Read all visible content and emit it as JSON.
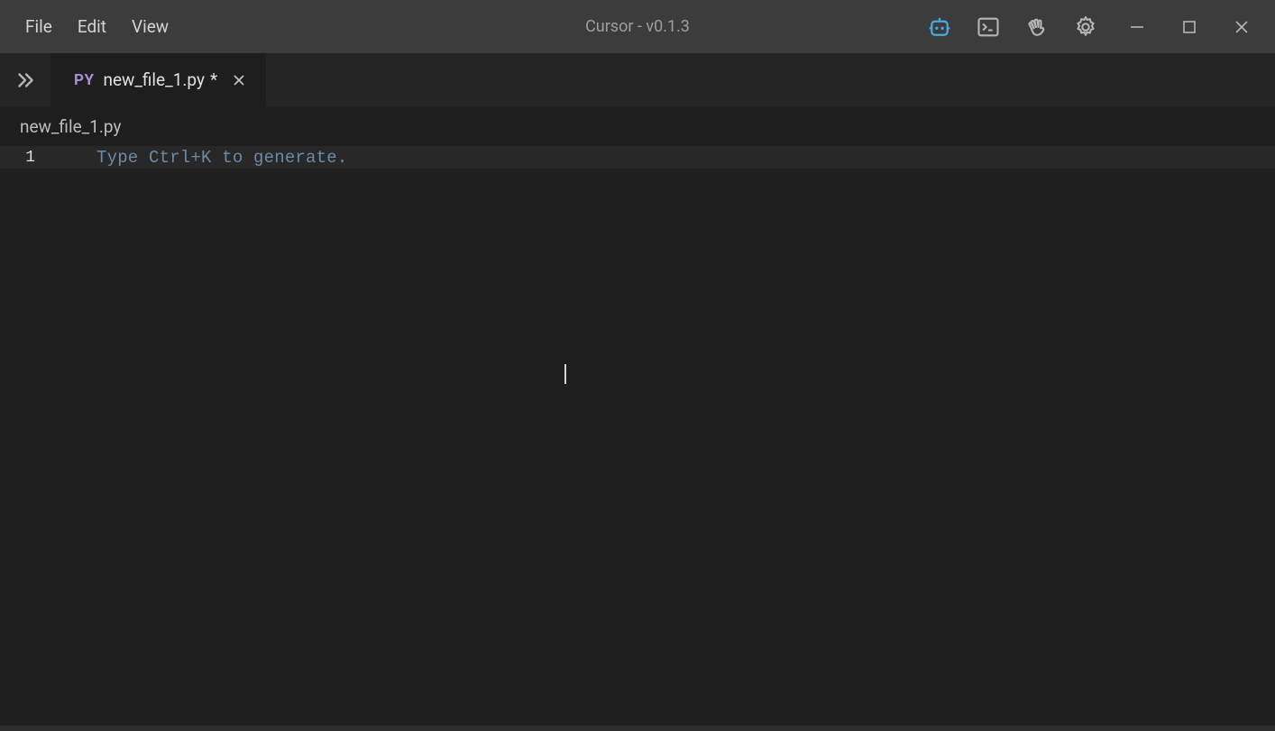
{
  "titlebar": {
    "menu": {
      "file": "File",
      "edit": "Edit",
      "view": "View"
    },
    "title": "Cursor - v0.1.3"
  },
  "tabs": {
    "active": {
      "badge": "PY",
      "filename": "new_file_1.py",
      "dirty_marker": "*"
    }
  },
  "breadcrumb": {
    "path": "new_file_1.py"
  },
  "editor": {
    "lines": [
      {
        "number": "1",
        "text": "Type Ctrl+K to generate."
      }
    ]
  },
  "icons": {
    "robot": "robot-icon",
    "terminal": "terminal-icon",
    "wave": "wave-icon",
    "settings": "settings-icon",
    "minimize": "minimize-icon",
    "maximize": "maximize-icon",
    "close": "close-icon",
    "expand": "chevron-double-right-icon",
    "tab_close": "close-icon"
  },
  "colors": {
    "accent": "#4aa8e0",
    "icon_stroke": "#b5b5b5",
    "py_badge": "#a88fd8"
  }
}
